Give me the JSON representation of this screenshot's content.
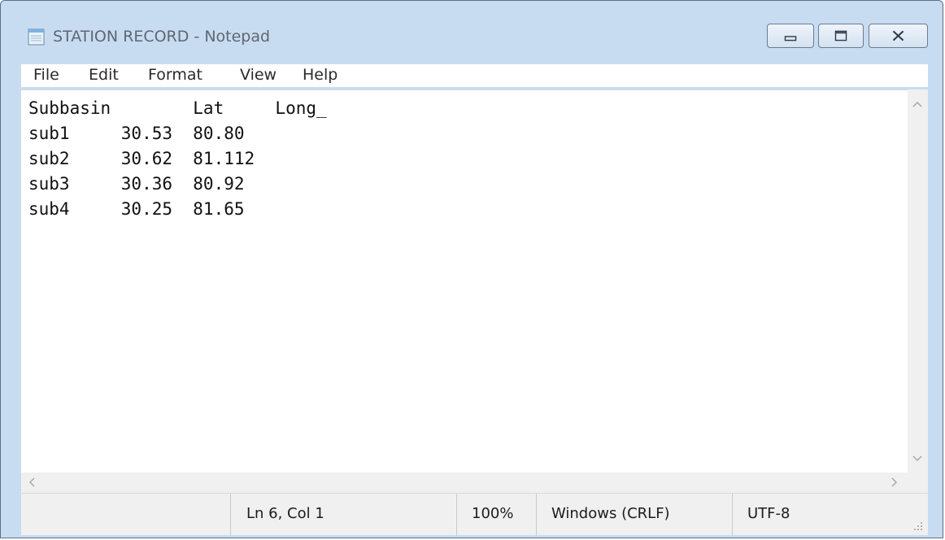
{
  "window": {
    "title": "STATION RECORD - Notepad",
    "icon": "notepad-icon",
    "controls": {
      "minimize": "minimize-icon",
      "maximize": "maximize-icon",
      "close": "close-icon"
    }
  },
  "menu": {
    "file": "File",
    "edit": "Edit",
    "format": "Format",
    "view": "View",
    "help": "Help"
  },
  "document": {
    "lines": [
      "Subbasin        Lat     Long_",
      "sub1     30.53  80.80",
      "sub2     30.62  81.112",
      "sub3     30.36  80.92",
      "sub4     30.25  81.65"
    ]
  },
  "status": {
    "cursor": "Ln 6, Col 1",
    "zoom": "100%",
    "line_ending": "Windows (CRLF)",
    "encoding": "UTF-8"
  },
  "colors": {
    "frame": "#c8dcf1",
    "close_hover": "#c42b1c"
  }
}
